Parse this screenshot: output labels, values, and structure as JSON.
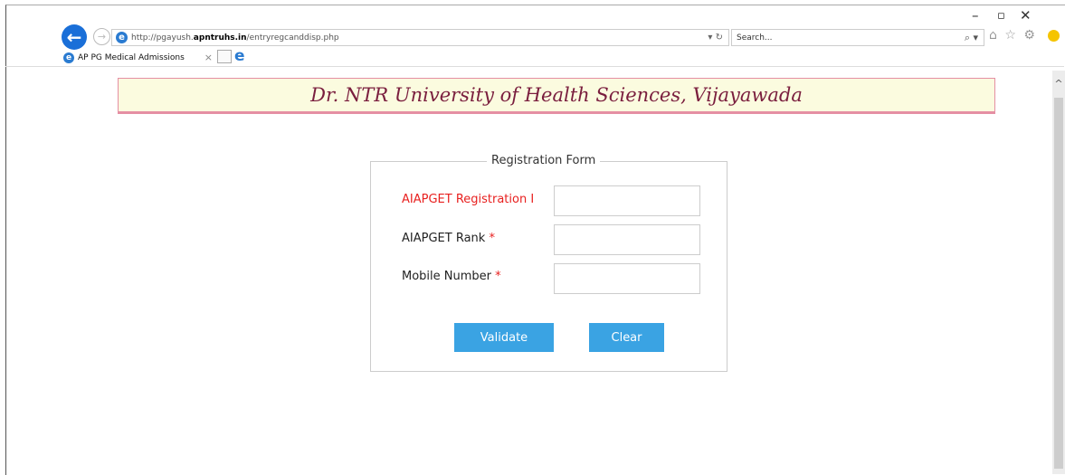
{
  "browser": {
    "window_controls": [
      "–",
      "▫",
      "✕"
    ],
    "url_prefix": "http://pgayush.",
    "url_host": "apntruhs.in",
    "url_path": "/entryregcanddisp.php",
    "url_controls": "▾ ↻",
    "search_placeholder": "Search...",
    "search_icon": "⌕ ▾",
    "toolbar_icons": "⌂ ☆ ⚙",
    "tab_title": "AP PG Medical Admissions",
    "tab_close": "×"
  },
  "banner": {
    "title": "Dr. NTR University of Health Sciences, Vijayawada"
  },
  "form": {
    "legend": "Registration Form",
    "fields": [
      {
        "label": "AIAPGET Registration I",
        "required_mark": "",
        "value": ""
      },
      {
        "label": "AIAPGET Rank",
        "required_mark": "*",
        "value": ""
      },
      {
        "label": "Mobile Number",
        "required_mark": "*",
        "value": ""
      }
    ],
    "validate_label": "Validate",
    "clear_label": "Clear"
  },
  "colors": {
    "button_bg": "#3aa3e3",
    "banner_bg": "#fbfbdf",
    "banner_border": "#e58fa3",
    "banner_text": "#7a1e3e",
    "required_red": "#e8201f"
  }
}
